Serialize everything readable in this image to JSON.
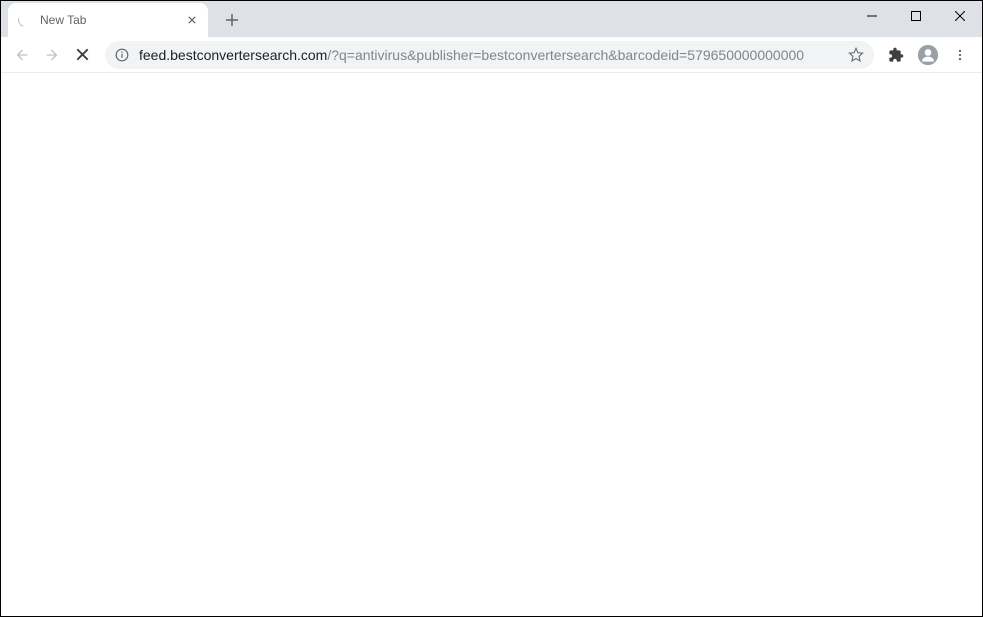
{
  "tab": {
    "title": "New Tab"
  },
  "url": {
    "domain": "feed.bestconvertersearch.com",
    "path": "/?q=antivirus&publisher=bestconvertersearch&barcodeid=579650000000000"
  }
}
